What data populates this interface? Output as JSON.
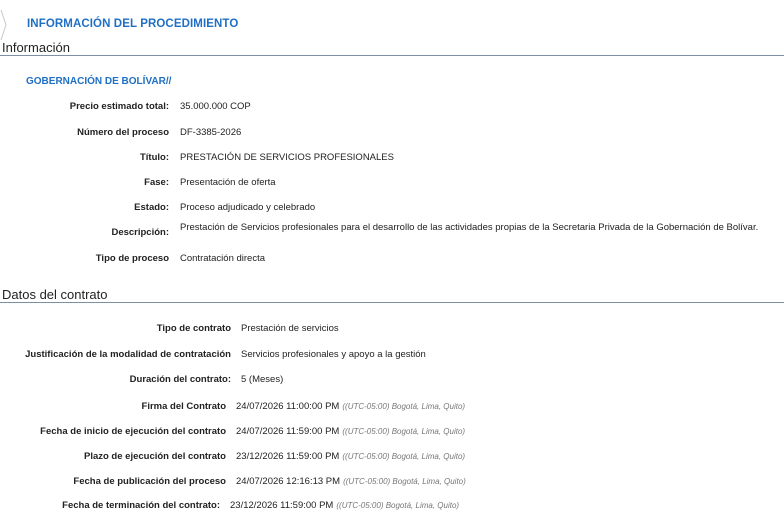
{
  "header": {
    "breadcrumb": "INFORMACIÓN DEL PROCEDIMIENTO"
  },
  "info": {
    "title": "Información",
    "entity": "GOBERNACIÓN DE BOLÍVAR//",
    "fields": [
      {
        "label": "Precio estimado total:",
        "value": "35.000.000 COP"
      },
      {
        "label": "Número del proceso",
        "value": "DF-3385-2026"
      },
      {
        "label": "Título:",
        "value": "PRESTACIÓN DE SERVICIOS PROFESIONALES"
      },
      {
        "label": "Fase:",
        "value": "Presentación de oferta"
      },
      {
        "label": "Estado:",
        "value": "Proceso adjudicado y celebrado"
      },
      {
        "label": "Descripción:",
        "value": "Prestación de Servicios profesionales para el desarrollo de las actividades propias de la Secretaria Privada de la Gobernación de Bolívar."
      },
      {
        "label": "Tipo de proceso",
        "value": "Contratación directa"
      }
    ]
  },
  "contract": {
    "title": "Datos del contrato",
    "fields": [
      {
        "label": "Tipo de contrato",
        "value": "Prestación de servicios"
      },
      {
        "label": "Justificación de la modalidad de contratación",
        "value": "Servicios profesionales y apoyo a la gestión"
      },
      {
        "label": "Duración del contrato:",
        "value": "5 (Meses)"
      },
      {
        "label": "Firma del Contrato",
        "value": "24/07/2026 11:00:00 PM",
        "tz": "((UTC-05:00) Bogotá, Lima, Quito)"
      },
      {
        "label": "Fecha de inicio de ejecución del contrato",
        "value": "24/07/2026 11:59:00 PM",
        "tz": "((UTC-05:00) Bogotá, Lima, Quito)"
      },
      {
        "label": "Plazo de ejecución del contrato",
        "value": "23/12/2026 11:59:00 PM",
        "tz": "((UTC-05:00) Bogotá, Lima, Quito)"
      },
      {
        "label": "Fecha de publicación del proceso",
        "value": "24/07/2026 12:16:13 PM",
        "tz": "((UTC-05:00) Bogotá, Lima, Quito)"
      },
      {
        "label": "Fecha de terminación del contrato:",
        "value": "23/12/2026 11:59:00 PM",
        "tz": "((UTC-05:00) Bogotá, Lima, Quito)"
      }
    ]
  }
}
